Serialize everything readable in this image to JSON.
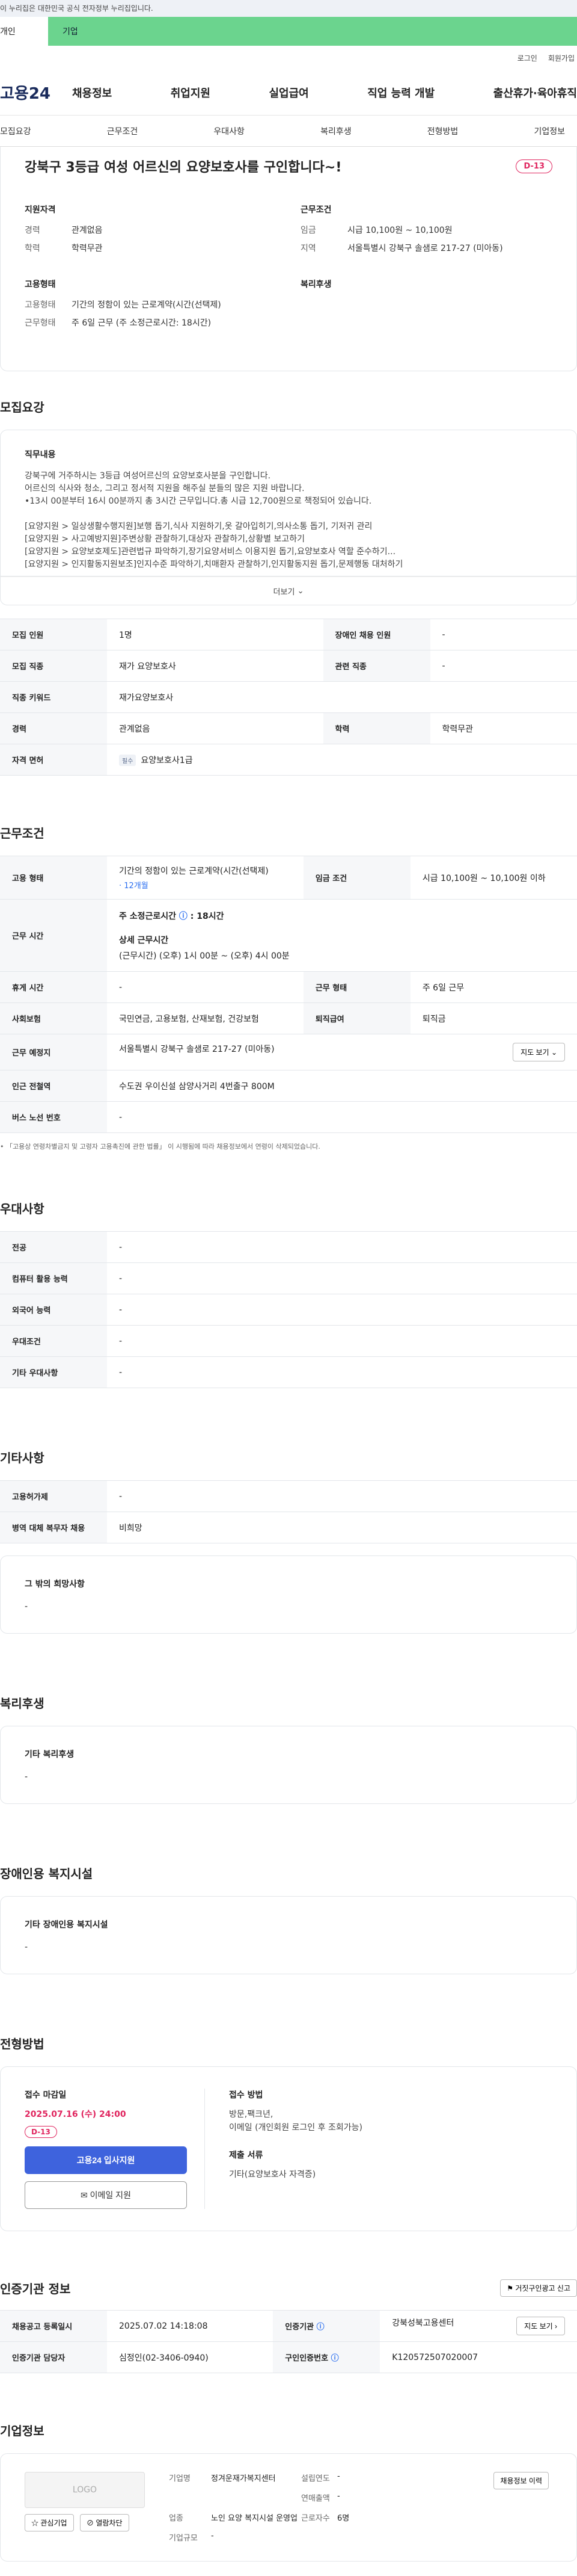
{
  "gov_banner": "이 누리집은 대한민국 공식 전자정부 누리집입니다.",
  "type_tabs": {
    "personal": "개인",
    "company": "기업"
  },
  "util": {
    "login": "로그인",
    "join": "회원가입"
  },
  "gnb": {
    "logo": "고용24",
    "menu": [
      "채용정보",
      "취업지원",
      "실업급여",
      "직업 능력 개발",
      "출산휴가·육아휴직"
    ]
  },
  "subnav": [
    "모집요강",
    "근무조건",
    "우대사항",
    "복리후생",
    "전형방법",
    "기업정보"
  ],
  "hero": {
    "title": "강북구 3등급 여성 어르신의 요양보호사를 구인합니다~!",
    "dday": "D-13",
    "qual_title": "지원자격",
    "qual": [
      {
        "k": "경력",
        "v": "관계없음"
      },
      {
        "k": "학력",
        "v": "학력무관"
      }
    ],
    "cond_title": "근무조건",
    "cond": [
      {
        "k": "임금",
        "v": "시급 10,100원 ~ 10,100원"
      },
      {
        "k": "지역",
        "v": "서울특별시 강북구 솔샘로 217-27 (미아동)"
      }
    ],
    "emp_title": "고용형태",
    "emp": [
      {
        "k": "고용형태",
        "v": "기간의 정함이 있는 근로계약(시간(선택제)"
      },
      {
        "k": "근무형태",
        "v": "주 6일 근무 (주 소정근로시간: 18시간)"
      }
    ],
    "welfare_title": "복리후생"
  },
  "recruit": {
    "title": "모집요강",
    "job_desc_title": "직무내용",
    "job_desc_lines": [
      "강북구에 거주하시는 3등급 여성어르신의 요양보호사분을 구인합니다.",
      "어르신의 식사와 청소, 그리고 정서적 지원을 해주실 분들의 많은 지원 바랍니다.",
      "•13시 00분부터 16시 00분까지 총 3시간 근무입니다.총 시급 12,700원으로 책정되어 있습니다.",
      "",
      "[요양지원 > 일상생활수행지원]보행 돕기,식사 지원하기,옷 갈아입히기,의사소통 돕기, 기저귀 관리",
      "[요양지원 > 사고예방지원]주변상황 관찰하기,대상자 관찰하기,상황별 보고하기",
      "[요양지원 > 요양보호제도]관련법규 파악하기,장기요양서비스 이용지원 돕기,요양보호사 역할 준수하기...",
      "[요양지원 > 인지활동지원보조]인지수준 파악하기,치매환자 관찰하기,인지활동지원 돕기,문제행동 대처하기"
    ],
    "more": "더보기",
    "rows": [
      {
        "k1": "모집 인원",
        "v1": "1명",
        "k2": "장애인 채용 인원",
        "v2": "-"
      },
      {
        "k1": "모집 직종",
        "v1": "재가 요양보호사",
        "k2": "관련 직종",
        "v2": "-"
      },
      {
        "k1": "직종 키워드",
        "v1": "재가요양보호사"
      },
      {
        "k1": "경력",
        "v1": "관계없음",
        "k2": "학력",
        "v2": "학력무관"
      }
    ],
    "license_label": "자격 면허",
    "license_tag": "필수",
    "license_value": "요양보호사1급"
  },
  "work": {
    "title": "근무조건",
    "emp_type_label": "고용 형태",
    "emp_type_value": "기간의 정함이 있는 근로계약(시간(선택제)",
    "emp_type_sub": "· 12개월",
    "wage_label": "임금 조건",
    "wage_value": "시급 10,100원 ~ 10,100원 이하",
    "hours_label": "근무 시간",
    "hours_main_prefix": "주 소정근로시간",
    "hours_main_value": ": 18시간",
    "hours_detail_title": "상세 근무시간",
    "hours_detail": "(근무시간) (오후) 1시 00분 ~ (오후) 4시 00분",
    "rows": [
      {
        "k1": "휴게 시간",
        "v1": "-",
        "k2": "근무 형태",
        "v2": "주 6일 근무"
      },
      {
        "k1": "사회보험",
        "v1": "국민연금, 고용보험, 산재보험, 건강보험",
        "k2": "퇴직급여",
        "v2": "퇴직금"
      }
    ],
    "place_label": "근무 예정지",
    "place_value": "서울특별시 강북구 솔샘로 217-27 (미아동)",
    "map_btn": "지도 보기",
    "station_label": "인근 전철역",
    "station_value": "수도권 우이신설 삼양사거리 4번출구 800M",
    "bus_label": "버스 노선 번호",
    "bus_value": "-",
    "note": "• 「고용상 연령차별금지 및 고령자 고용촉진에 관한 법률」 이 시행됨에 따라 채용정보에서 연령이 삭제되었습니다."
  },
  "pref": {
    "title": "우대사항",
    "rows": [
      {
        "k": "전공",
        "v": "-"
      },
      {
        "k": "컴퓨터 활용 능력",
        "v": "-"
      },
      {
        "k": "외국어 능력",
        "v": "-"
      },
      {
        "k": "우대조건",
        "v": "-"
      },
      {
        "k": "기타 우대사항",
        "v": "-"
      }
    ]
  },
  "etc": {
    "title": "기타사항",
    "rows": [
      {
        "k": "고용허가제",
        "v": "-"
      },
      {
        "k": "병역 대체 복무자 채용",
        "v": "비희망"
      }
    ],
    "other_title": "그 밖의 희망사항",
    "other_value": "-"
  },
  "welfare": {
    "title": "복리후생",
    "sub": "기타 복리후생",
    "value": "-"
  },
  "disabled": {
    "title": "장애인용 복지시설",
    "sub": "기타 장애인용 복지시설",
    "value": "-"
  },
  "process": {
    "title": "전형방법",
    "deadline_title": "접수 마감일",
    "deadline": "2025.07.16 (수) 24:00",
    "dday": "D-13",
    "apply_btn": "고용24 입사지원",
    "email_btn": "이메일 지원",
    "method_title": "접수 방법",
    "method_lines": [
      "방문,팩크년,",
      "이메일 (개인회원 로그인 후 조회가능)"
    ],
    "docs_title": "제출 서류",
    "docs": "기타(요양보호사 자격증)"
  },
  "agency": {
    "title": "인증기관 정보",
    "report_btn": "거짓구인광고 신고",
    "rows": [
      {
        "k1": "채용공고 등록일시",
        "v1": "2025.07.02 14:18:08",
        "k2": "인증기관",
        "v2": "강북성북고용센터"
      },
      {
        "k1": "인증기관 담당자",
        "v1": "심정인(02-3406-0940)",
        "k2": "구인인증번호",
        "v2": "K120572507020007"
      }
    ],
    "map_btn": "지도 보기"
  },
  "company": {
    "title": "기업정보",
    "logo": "LOGO",
    "fav_btn": "관심기업",
    "block_btn": "열람차단",
    "name_label": "기업명",
    "name_value": "정겨운재가복지센터",
    "founded_label": "설립연도",
    "founded_value": "-",
    "sales_label": "연매출액",
    "sales_value": "-",
    "industry_label": "업종",
    "industry_value": "노인 요양 복지시설 운영업",
    "emp_label": "근로자수",
    "emp_value": "6명",
    "size_label": "기업규모",
    "size_value": "-",
    "history_btn": "채용정보 이력"
  }
}
